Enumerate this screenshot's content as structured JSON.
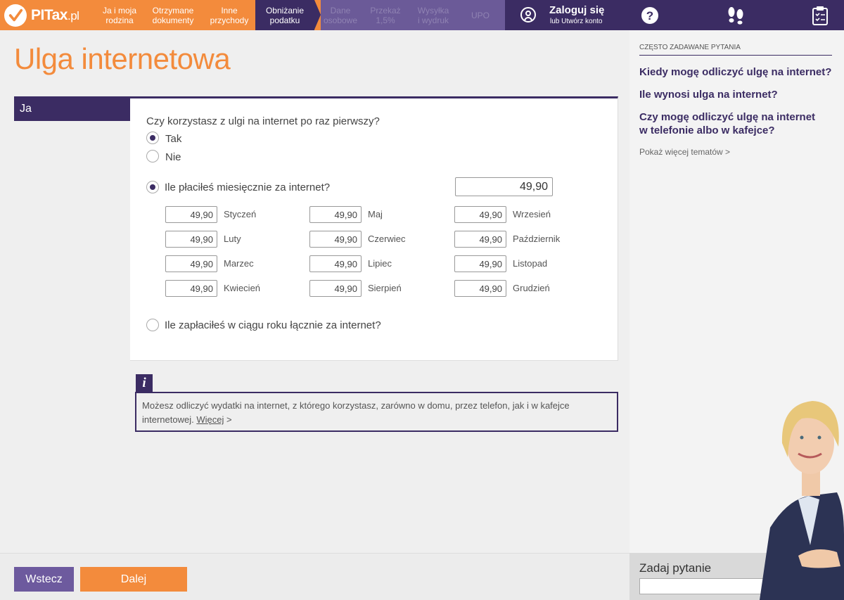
{
  "brand": {
    "name": "PITax",
    "suffix": ".pl"
  },
  "steps": [
    {
      "label": "Ja i moja\nrodzina",
      "state": "done"
    },
    {
      "label": "Otrzymane\ndokumenty",
      "state": "done"
    },
    {
      "label": "Inne\nprzychody",
      "state": "done"
    },
    {
      "label": "Obniżanie\npodatku",
      "state": "current"
    },
    {
      "label": "Dane\nosobowe",
      "state": "future"
    },
    {
      "label": "Przekaż\n1,5%",
      "state": "future"
    },
    {
      "label": "Wysyłka\ni wydruk",
      "state": "future"
    },
    {
      "label": "UPO",
      "state": "future"
    }
  ],
  "login": {
    "title": "Zaloguj się",
    "subtitle": "lub Utwórz konto"
  },
  "right_tabs": [
    {
      "icon": "question-icon"
    },
    {
      "icon": "footsteps-icon"
    },
    {
      "icon": "clipboard-icon"
    }
  ],
  "page": {
    "title": "Ulga internetowa",
    "person_tab": "Ja"
  },
  "form": {
    "q1": "Czy korzystasz z ulgi na internet po raz pierwszy?",
    "q1_options": [
      {
        "label": "Tak",
        "selected": true
      },
      {
        "label": "Nie",
        "selected": false
      }
    ],
    "monthly_label": "Ile płaciłeś miesięcznie za internet?",
    "monthly_selected": true,
    "monthly_total": "49,90",
    "months": [
      {
        "name": "Styczeń",
        "value": "49,90"
      },
      {
        "name": "Luty",
        "value": "49,90"
      },
      {
        "name": "Marzec",
        "value": "49,90"
      },
      {
        "name": "Kwiecień",
        "value": "49,90"
      },
      {
        "name": "Maj",
        "value": "49,90"
      },
      {
        "name": "Czerwiec",
        "value": "49,90"
      },
      {
        "name": "Lipiec",
        "value": "49,90"
      },
      {
        "name": "Sierpień",
        "value": "49,90"
      },
      {
        "name": "Wrzesień",
        "value": "49,90"
      },
      {
        "name": "Październik",
        "value": "49,90"
      },
      {
        "name": "Listopad",
        "value": "49,90"
      },
      {
        "name": "Grudzień",
        "value": "49,90"
      }
    ],
    "yearly_label": "Ile zapłaciłeś w ciągu roku łącznie za internet?",
    "yearly_selected": false
  },
  "info": {
    "icon_letter": "i",
    "text": "Możesz odliczyć wydatki na internet, z którego korzystasz, zarówno w domu, przez telefon, jak i w kafejce internetowej.",
    "link": "Więcej",
    "link_arrow": ">"
  },
  "buttons": {
    "back": "Wstecz",
    "next": "Dalej"
  },
  "faq": {
    "heading": "CZĘSTO ZADAWANE PYTANIA",
    "items": [
      "Kiedy mogę odliczyć ulgę na internet?",
      "Ile wynosi ulga na internet?",
      "Czy mogę odliczyć ulgę na internet w telefonie albo w kafejce?"
    ],
    "more": "Pokaż więcej tematów >"
  },
  "ask": {
    "label": "Zadaj pytanie",
    "value": ""
  },
  "colors": {
    "orange": "#f38b3c",
    "purple": "#3b2c63",
    "purple_light": "#6b5a98"
  }
}
